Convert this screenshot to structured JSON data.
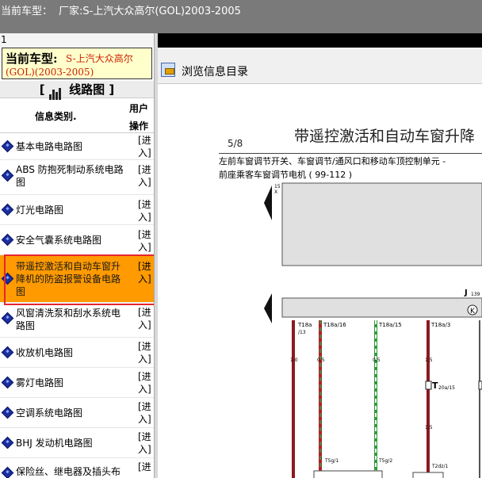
{
  "window": {
    "title_label": "当前车型：",
    "title_value": "厂家:S-上汽大众高尔(GOL)2003-2005"
  },
  "left_panel": {
    "page_index": "1",
    "current_model_label": "当前车型:",
    "current_model_value_line1": "S-上汽大众高尔",
    "current_model_value_line2": "(GOL)(2003-2005)",
    "section_title": "线路图",
    "section_bracket_open": "[",
    "section_bracket_close": "]",
    "col_category": "信息类别.",
    "col_user_op_line1": "用户",
    "col_user_op_line2": "操作",
    "items": [
      {
        "line1": "基本电路电路图",
        "line2": "",
        "line3": "",
        "enter1": "[进",
        "enter2": "入]"
      },
      {
        "line1": "ABS 防抱死制动系统电路",
        "line2": "图",
        "line3": "",
        "enter1": "[进",
        "enter2": "入]"
      },
      {
        "line1": "灯光电路图",
        "line2": "",
        "line3": "",
        "enter1": "[进",
        "enter2": "入]"
      },
      {
        "line1": "安全气囊系统电路图",
        "line2": "",
        "line3": "",
        "enter1": "[进",
        "enter2": "入]"
      },
      {
        "line1": "带遥控激活和自动车窗升",
        "line2": "降机的防盗报警设备电路",
        "line3": "图",
        "enter1": "[进",
        "enter2": "入]"
      },
      {
        "line1": "风窗清洗泵和刮水系统电",
        "line2": "路图",
        "line3": "",
        "enter1": "[进",
        "enter2": "入]"
      },
      {
        "line1": "收放机电路图",
        "line2": "",
        "line3": "",
        "enter1": "[进",
        "enter2": "入]"
      },
      {
        "line1": "雾灯电路图",
        "line2": "",
        "line3": "",
        "enter1": "[进",
        "enter2": "入]"
      },
      {
        "line1": "空调系统电路图",
        "line2": "",
        "line3": "",
        "enter1": "[进",
        "enter2": "入]"
      },
      {
        "line1": "BHJ 发动机电路图",
        "line2": "",
        "line3": "",
        "enter1": "[进",
        "enter2": "入]"
      },
      {
        "line1": "保险丝、继电器及插头布",
        "line2": "",
        "line3": "",
        "enter1": "[进",
        "enter2": ""
      }
    ]
  },
  "right_panel": {
    "browse_label": "浏览信息目录",
    "diagram": {
      "title": "带遥控激活和自动车窗升降",
      "page": "5/8",
      "desc_line1": "左前车窗调节开关、车窗调节/通风口和移动车顶控制单元 -",
      "desc_line2": "前座乘客车窗调节电机 ( 99-112 )",
      "component_label": "J",
      "component_sub": "139",
      "side_mark": "15",
      "side_mark2": "X",
      "pins_top": [
        "T18a",
        "T18a/16",
        "T18a/15",
        "T18a/3"
      ],
      "pin_sub": "/13",
      "wire_sizes": [
        "1.0",
        "0.5",
        "0.5",
        "1.5"
      ],
      "wire_size_lower": "1.5",
      "connector_label": "T",
      "connector_sub": "20a/15",
      "pins_bottom": [
        "T5g/1",
        "T5g/2",
        "T2dz/1"
      ],
      "colors": {
        "wire_red": "#b0202a",
        "wire_green": "#2f9a3a",
        "wire_dark": "#333333",
        "box_fill": "#e0e0e0"
      }
    }
  },
  "colors": {
    "title_bar": "#7a7a7a",
    "active_row": "#ff9a00",
    "highlight_border": "#e3262f",
    "model_box": "#ffffcc",
    "model_value": "#cc2200",
    "diamond": "#1b2f9e"
  }
}
